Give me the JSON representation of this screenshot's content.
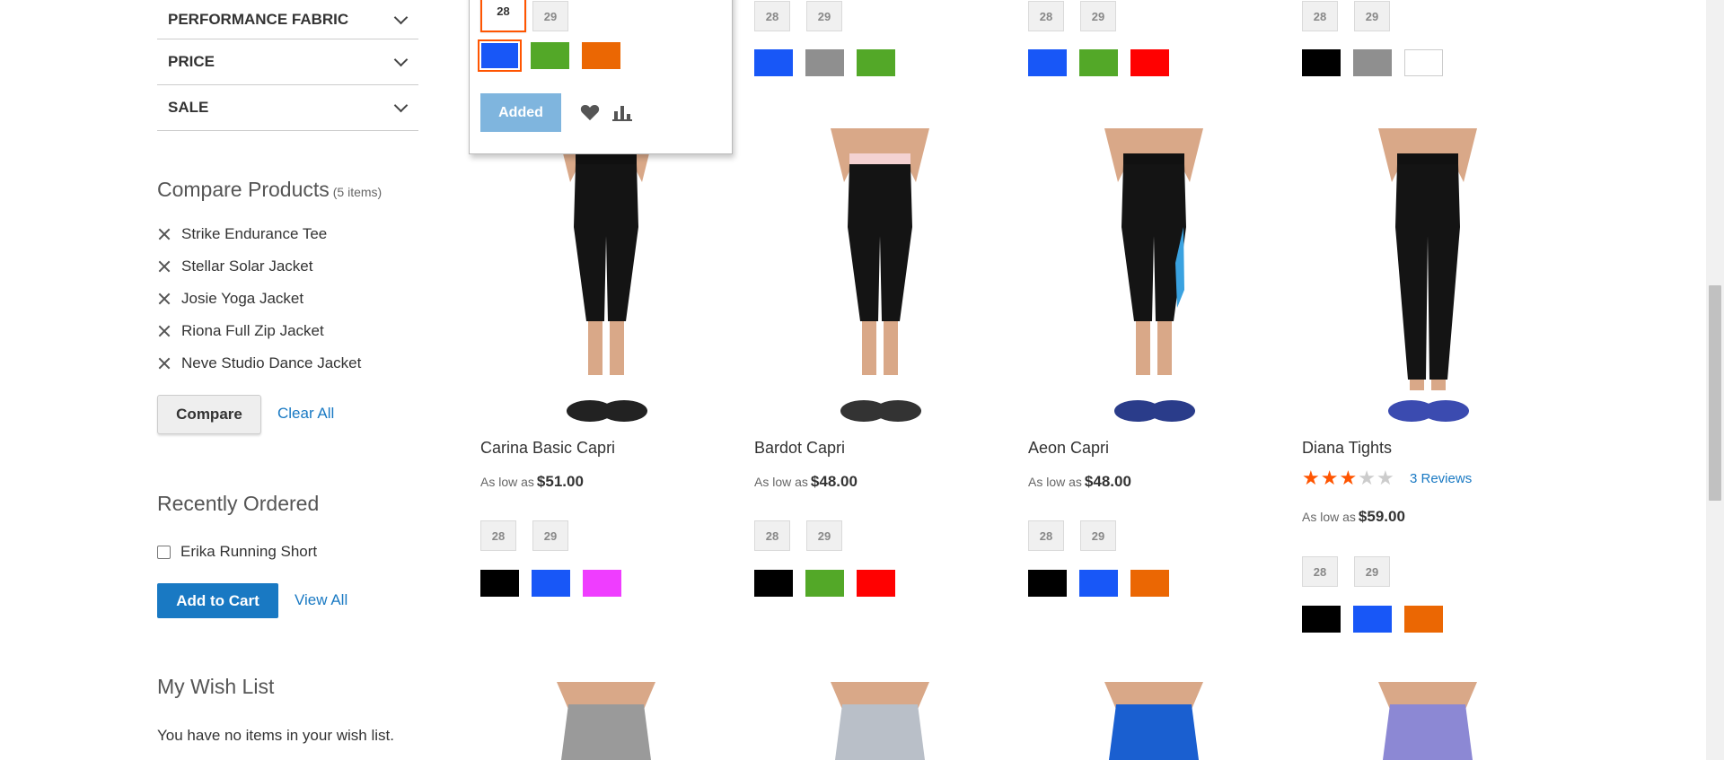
{
  "filters": [
    {
      "label": "PERFORMANCE FABRIC"
    },
    {
      "label": "PRICE"
    },
    {
      "label": "SALE"
    }
  ],
  "compare": {
    "title": "Compare Products",
    "count": "(5 items)",
    "items": [
      "Strike Endurance Tee",
      "Stellar Solar Jacket",
      "Josie Yoga Jacket",
      "Riona Full Zip Jacket",
      "Neve Studio Dance Jacket"
    ],
    "compare_label": "Compare",
    "clear_label": "Clear All"
  },
  "recent": {
    "title": "Recently Ordered",
    "item": "Erika Running Short",
    "add_label": "Add to Cart",
    "view_label": "View All"
  },
  "wishlist": {
    "title": "My Wish List",
    "empty": "You have no items in your wish list."
  },
  "top_row": [
    {
      "sizes": [
        "28",
        "29"
      ],
      "selected_size": "28",
      "colors": [
        "#1857f7",
        "#53a828",
        "#eb6703"
      ],
      "selected_color": 0,
      "added_label": "Added"
    },
    {
      "sizes": [
        "28",
        "29"
      ],
      "colors": [
        "#1857f7",
        "#8f8f8f",
        "#53a828"
      ]
    },
    {
      "sizes": [
        "28",
        "29"
      ],
      "colors": [
        "#1857f7",
        "#53a828",
        "#ff0101"
      ]
    },
    {
      "sizes": [
        "28",
        "29"
      ],
      "colors": [
        "#000000",
        "#8f8f8f",
        "#ffffff"
      ]
    }
  ],
  "products": [
    {
      "name": "Carina Basic Capri",
      "price_prefix": "As low as",
      "price": "$51.00",
      "sizes": [
        "28",
        "29"
      ],
      "colors": [
        "#000000",
        "#1857f7",
        "#ef3dff"
      ]
    },
    {
      "name": "Bardot Capri",
      "price_prefix": "As low as",
      "price": "$48.00",
      "sizes": [
        "28",
        "29"
      ],
      "colors": [
        "#000000",
        "#53a828",
        "#ff0101"
      ]
    },
    {
      "name": "Aeon Capri",
      "price_prefix": "As low as",
      "price": "$48.00",
      "sizes": [
        "28",
        "29"
      ],
      "colors": [
        "#000000",
        "#1857f7",
        "#eb6703"
      ]
    },
    {
      "name": "Diana Tights",
      "price_prefix": "As low as",
      "price": "$59.00",
      "rating": 3,
      "reviews": "3 Reviews",
      "sizes": [
        "28",
        "29"
      ],
      "colors": [
        "#000000",
        "#1857f7",
        "#eb6703"
      ]
    }
  ],
  "icons": {
    "wishlist": "heart-icon",
    "compare": "chart-icon",
    "remove": "close-icon",
    "expand": "chevron-down-icon",
    "rating": "star-icon"
  },
  "accent": "#ff5501",
  "link_color": "#1979c3"
}
